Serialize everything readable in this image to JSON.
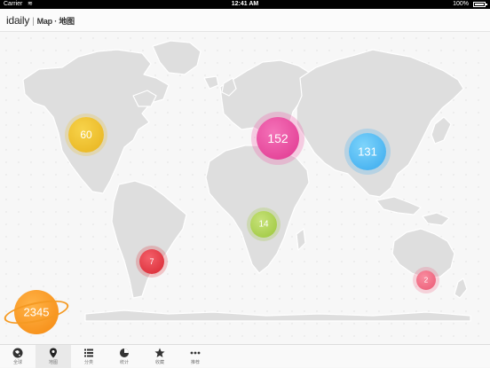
{
  "status_bar": {
    "carrier": "Carrier",
    "time": "12:41 AM",
    "battery": "100%"
  },
  "header": {
    "brand": "idaily",
    "title": "Map · 地图"
  },
  "regions": [
    {
      "name": "north-america",
      "count": "60",
      "color": "#e9b824"
    },
    {
      "name": "europe",
      "count": "152",
      "color": "#e8449a"
    },
    {
      "name": "asia",
      "count": "131",
      "color": "#45b0ee"
    },
    {
      "name": "africa",
      "count": "14",
      "color": "#a6cc45"
    },
    {
      "name": "south-america",
      "count": "7",
      "color": "#dc2d38"
    },
    {
      "name": "oceania",
      "count": "2",
      "color": "#ee6680"
    }
  ],
  "total": {
    "count": "2345",
    "color": "#f5880f"
  },
  "tabs": [
    {
      "label": "全球",
      "icon": "globe-icon",
      "active": false
    },
    {
      "label": "地图",
      "icon": "map-pin-icon",
      "active": true
    },
    {
      "label": "分类",
      "icon": "list-icon",
      "active": false
    },
    {
      "label": "统计",
      "icon": "pie-chart-icon",
      "active": false
    },
    {
      "label": "收藏",
      "icon": "star-icon",
      "active": false
    },
    {
      "label": "推荐",
      "icon": "more-icon",
      "active": false
    }
  ]
}
